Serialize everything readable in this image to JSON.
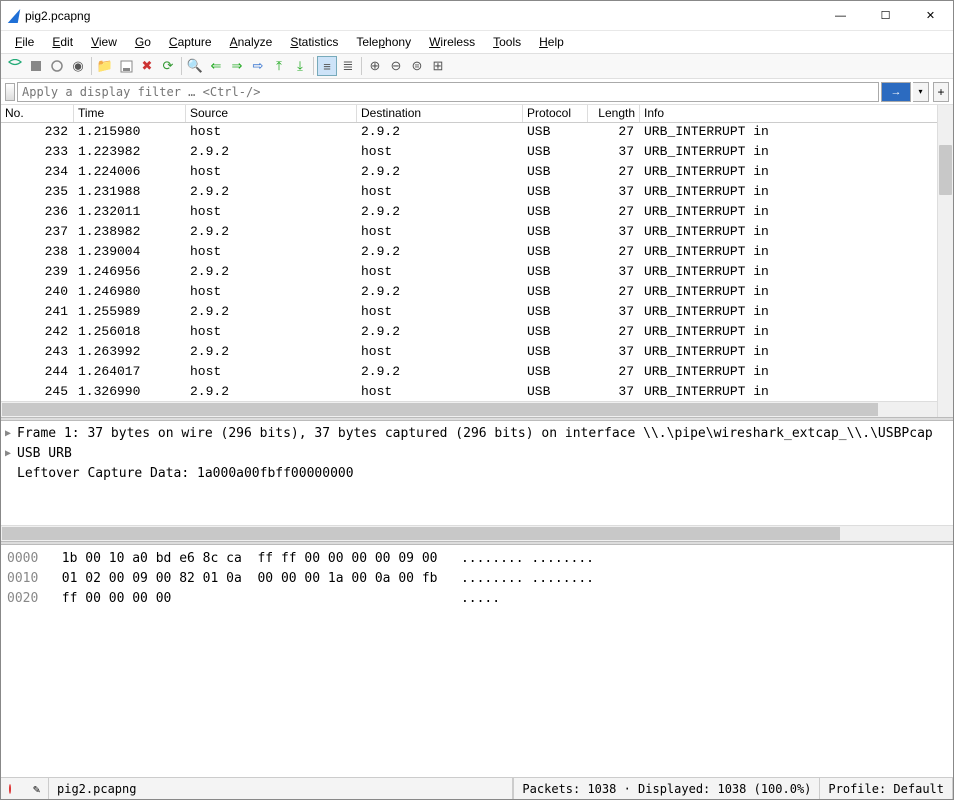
{
  "title": "pig2.pcapng",
  "menu": [
    "File",
    "Edit",
    "View",
    "Go",
    "Capture",
    "Analyze",
    "Statistics",
    "Telephony",
    "Wireless",
    "Tools",
    "Help"
  ],
  "menu_accel": [
    0,
    0,
    0,
    0,
    0,
    0,
    0,
    4,
    0,
    0,
    0
  ],
  "filter_placeholder": "Apply a display filter … <Ctrl-/>",
  "columns": {
    "no": "No.",
    "time": "Time",
    "src": "Source",
    "dst": "Destination",
    "proto": "Protocol",
    "len": "Length",
    "info": "Info"
  },
  "packets": [
    {
      "no": 232,
      "time": "1.215980",
      "src": "host",
      "dst": "2.9.2",
      "proto": "USB",
      "len": 27,
      "info": "URB_INTERRUPT in"
    },
    {
      "no": 233,
      "time": "1.223982",
      "src": "2.9.2",
      "dst": "host",
      "proto": "USB",
      "len": 37,
      "info": "URB_INTERRUPT in"
    },
    {
      "no": 234,
      "time": "1.224006",
      "src": "host",
      "dst": "2.9.2",
      "proto": "USB",
      "len": 27,
      "info": "URB_INTERRUPT in"
    },
    {
      "no": 235,
      "time": "1.231988",
      "src": "2.9.2",
      "dst": "host",
      "proto": "USB",
      "len": 37,
      "info": "URB_INTERRUPT in"
    },
    {
      "no": 236,
      "time": "1.232011",
      "src": "host",
      "dst": "2.9.2",
      "proto": "USB",
      "len": 27,
      "info": "URB_INTERRUPT in"
    },
    {
      "no": 237,
      "time": "1.238982",
      "src": "2.9.2",
      "dst": "host",
      "proto": "USB",
      "len": 37,
      "info": "URB_INTERRUPT in"
    },
    {
      "no": 238,
      "time": "1.239004",
      "src": "host",
      "dst": "2.9.2",
      "proto": "USB",
      "len": 27,
      "info": "URB_INTERRUPT in"
    },
    {
      "no": 239,
      "time": "1.246956",
      "src": "2.9.2",
      "dst": "host",
      "proto": "USB",
      "len": 37,
      "info": "URB_INTERRUPT in"
    },
    {
      "no": 240,
      "time": "1.246980",
      "src": "host",
      "dst": "2.9.2",
      "proto": "USB",
      "len": 27,
      "info": "URB_INTERRUPT in"
    },
    {
      "no": 241,
      "time": "1.255989",
      "src": "2.9.2",
      "dst": "host",
      "proto": "USB",
      "len": 37,
      "info": "URB_INTERRUPT in"
    },
    {
      "no": 242,
      "time": "1.256018",
      "src": "host",
      "dst": "2.9.2",
      "proto": "USB",
      "len": 27,
      "info": "URB_INTERRUPT in"
    },
    {
      "no": 243,
      "time": "1.263992",
      "src": "2.9.2",
      "dst": "host",
      "proto": "USB",
      "len": 37,
      "info": "URB_INTERRUPT in"
    },
    {
      "no": 244,
      "time": "1.264017",
      "src": "host",
      "dst": "2.9.2",
      "proto": "USB",
      "len": 27,
      "info": "URB_INTERRUPT in"
    },
    {
      "no": 245,
      "time": "1.326990",
      "src": "2.9.2",
      "dst": "host",
      "proto": "USB",
      "len": 37,
      "info": "URB_INTERRUPT in"
    }
  ],
  "details": {
    "frame": "Frame 1: 37 bytes on wire (296 bits), 37 bytes captured (296 bits) on interface \\\\.\\pipe\\wireshark_extcap_\\\\.\\USBPcap",
    "urb": "USB URB",
    "leftover": "Leftover Capture Data: 1a000a00fbff00000000"
  },
  "hex": [
    {
      "off": "0000",
      "b": "1b 00 10 a0 bd e6 8c ca  ff ff 00 00 00 00 09 00",
      "a": "........ ........"
    },
    {
      "off": "0010",
      "b": "01 02 00 09 00 82 01 0a  00 00 00 1a 00 0a 00 fb",
      "a": "........ ........"
    },
    {
      "off": "0020",
      "b": "ff 00 00 00 00",
      "a": "....."
    }
  ],
  "status": {
    "file": "pig2.pcapng",
    "packets": "Packets: 1038 · Displayed: 1038 (100.0%)",
    "profile": "Profile: Default"
  }
}
